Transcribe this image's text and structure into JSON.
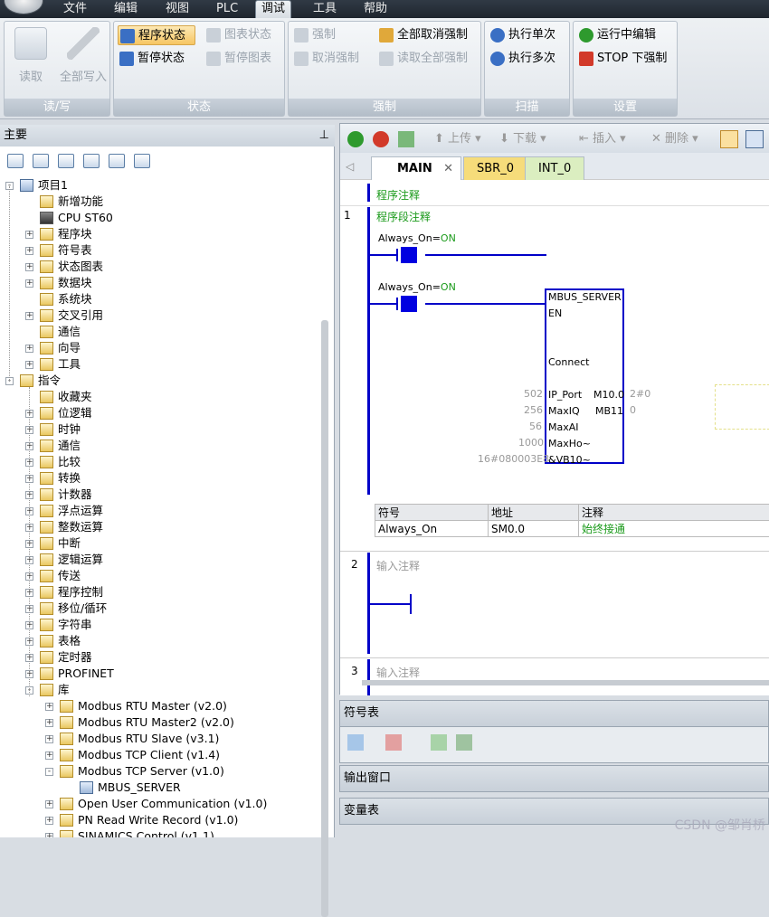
{
  "menubar": {
    "items": [
      "文件",
      "编辑",
      "视图",
      "PLC",
      "调试",
      "工具",
      "帮助"
    ],
    "active": "调试"
  },
  "ribbon": {
    "groups": {
      "rw": {
        "label": "读/写",
        "read": "读取",
        "write_all": "全部写入"
      },
      "status": {
        "label": "状态",
        "program_status": "程序状态",
        "pause_status": "暂停状态",
        "chart_status": "图表状态",
        "pause_chart": "暂停图表"
      },
      "force": {
        "label": "强制",
        "force": "强制",
        "unforce": "取消强制",
        "unforce_all": "全部取消强制",
        "read_all_forced": "读取全部强制"
      },
      "scan": {
        "label": "扫描",
        "single": "执行单次",
        "multi": "执行多次"
      },
      "settings": {
        "label": "设置",
        "run_edit": "运行中编辑",
        "stop_force": "STOP 下强制"
      }
    }
  },
  "left_panel": {
    "title": "主要",
    "pin": "ᵖ",
    "project": "项目1",
    "project_items": [
      "新增功能",
      "CPU ST60",
      "程序块",
      "符号表",
      "状态图表",
      "数据块",
      "系统块",
      "交叉引用",
      "通信",
      "向导",
      "工具"
    ],
    "instructions": "指令",
    "instruction_items": [
      "收藏夹",
      "位逻辑",
      "时钟",
      "通信",
      "比较",
      "转换",
      "计数器",
      "浮点运算",
      "整数运算",
      "中断",
      "逻辑运算",
      "传送",
      "程序控制",
      "移位/循环",
      "字符串",
      "表格",
      "定时器",
      "PROFINET",
      "库"
    ],
    "library_items": [
      "Modbus RTU Master (v2.0)",
      "Modbus RTU Master2 (v2.0)",
      "Modbus RTU Slave (v3.1)",
      "Modbus TCP Client (v1.4)",
      "Modbus TCP Server (v1.0)",
      "MBUS_SERVER",
      "Open User Communication (v1.0)",
      "PN Read Write Record (v1.0)",
      "SINAMICS Control (v1.1)"
    ]
  },
  "editor": {
    "toolbar": {
      "upload": "上传",
      "download": "下载",
      "insert": "插入",
      "delete": "删除"
    },
    "tabs": [
      "MAIN",
      "SBR_0",
      "INT_0"
    ],
    "active_tab": "MAIN",
    "program_comment": "程序注释",
    "networks": [
      {
        "num": "1",
        "comment": "程序段注释"
      },
      {
        "num": "2",
        "comment": "输入注释"
      },
      {
        "num": "3",
        "comment": "输入注释"
      }
    ],
    "contact1": {
      "symbol": "Always_On",
      "eq": "=",
      "state": "ON"
    },
    "contact2": {
      "symbol": "Always_On",
      "eq": "=",
      "state": "ON"
    },
    "block": {
      "name": "MBUS_SERVER",
      "en": "EN",
      "connect": "Connect",
      "inputs": [
        {
          "pin": "IP_Port",
          "value": "502"
        },
        {
          "pin": "MaxIQ",
          "value": "256"
        },
        {
          "pin": "MaxAI",
          "value": "56"
        },
        {
          "pin": "MaxHo~",
          "value": "1000"
        },
        {
          "pin": "&VB10~",
          "value": "16#080003E8"
        }
      ],
      "outputs": [
        {
          "addr": "M10.0",
          "value": "2#0"
        },
        {
          "addr": "MB11",
          "value": "0"
        }
      ]
    },
    "symbol_table": {
      "headers": [
        "符号",
        "地址",
        "注释"
      ],
      "rows": [
        [
          "Always_On",
          "SM0.0",
          "始终接通"
        ]
      ]
    }
  },
  "panes": {
    "symbol_table": "符号表",
    "output": "输出窗口",
    "variable": "变量表"
  },
  "watermark": "CSDN @邹肖桥",
  "colors": {
    "ladder_blue": "#0000c8",
    "status_green": "#1a9a1a",
    "accent_orange": "#f6c563"
  }
}
